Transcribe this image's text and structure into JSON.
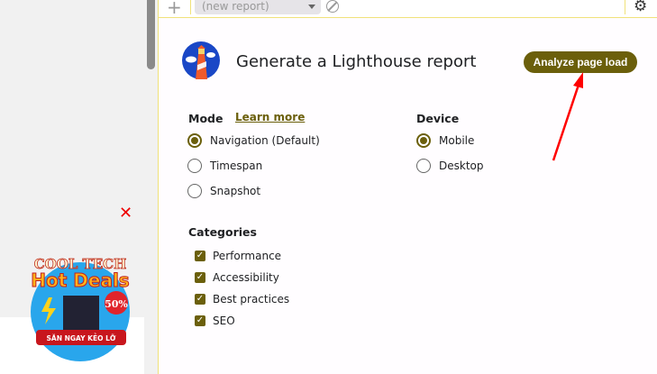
{
  "toolbar": {
    "report_select": "(new report)",
    "add_icon": "plus-icon",
    "clear_icon": "block-icon",
    "settings_icon": "gear-icon"
  },
  "header": {
    "title": "Generate a Lighthouse report",
    "analyze_button": "Analyze page load"
  },
  "mode": {
    "label": "Mode",
    "learn_more": "Learn more",
    "options": [
      {
        "label": "Navigation (Default)",
        "selected": true
      },
      {
        "label": "Timespan",
        "selected": false
      },
      {
        "label": "Snapshot",
        "selected": false
      }
    ]
  },
  "device": {
    "label": "Device",
    "options": [
      {
        "label": "Mobile",
        "selected": true
      },
      {
        "label": "Desktop",
        "selected": false
      }
    ]
  },
  "categories": {
    "label": "Categories",
    "items": [
      {
        "label": "Performance",
        "checked": true
      },
      {
        "label": "Accessibility",
        "checked": true
      },
      {
        "label": "Best practices",
        "checked": true
      },
      {
        "label": "SEO",
        "checked": true
      }
    ]
  },
  "ad": {
    "close": "✕",
    "line1": "COOL TECH",
    "line2": "Hot Deals",
    "badge": "50%",
    "cta": "SĂN NGAY KẺO LỠ"
  },
  "colors": {
    "accent": "#6b5f0b",
    "border": "#f0e27a",
    "annotation_arrow": "#ff0000"
  }
}
